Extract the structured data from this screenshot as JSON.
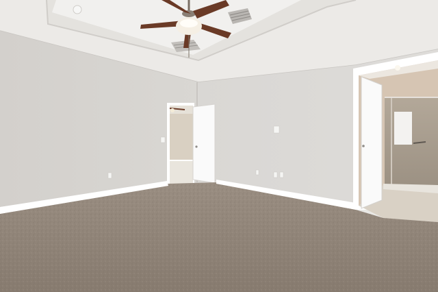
{
  "scene": {
    "subject": "empty-bedroom",
    "colors": {
      "ceiling": "#eeedeb",
      "wall_light": "#dcdad7",
      "wall_shade": "#c9c6c2",
      "trim": "#ffffff",
      "carpet": "#8e8276",
      "carpet_light": "#a3978b",
      "fan_blade": "#6a3a26",
      "tile": "#a79c8f",
      "bath_wall": "#d8c6b2"
    }
  }
}
